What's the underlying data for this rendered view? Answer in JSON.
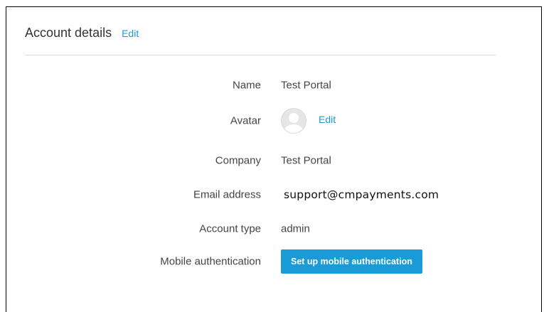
{
  "header": {
    "title": "Account details",
    "edit_label": "Edit"
  },
  "fields": {
    "name": {
      "label": "Name",
      "value": "Test Portal"
    },
    "avatar": {
      "label": "Avatar",
      "edit_label": "Edit",
      "icon": "user-avatar-placeholder-icon"
    },
    "company": {
      "label": "Company",
      "value": "Test Portal"
    },
    "email": {
      "label": "Email address",
      "value": "support@cmpayments.com"
    },
    "account_type": {
      "label": "Account type",
      "value": "admin"
    },
    "mobile_auth": {
      "label": "Mobile authentication",
      "button_label": "Set up mobile authentication"
    }
  },
  "colors": {
    "accent": "#1a9ad6",
    "text": "#444444",
    "divider": "#d9d9d9"
  }
}
